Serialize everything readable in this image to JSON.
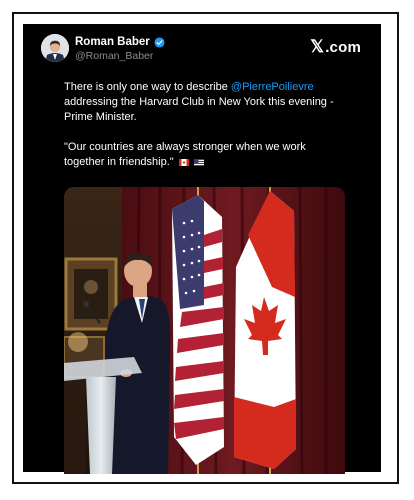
{
  "post": {
    "author": {
      "display_name": "Roman Baber",
      "handle": "@Roman_Baber",
      "verified": true
    },
    "brand": {
      "symbol": "𝕏",
      "label": ".com"
    },
    "text": {
      "line1_prefix": "There is only one way to describe ",
      "mention": "@PierrePoilievre",
      "line1_suffix": " addressing the Harvard Club in New York this evening - Prime Minister.",
      "quote": "\"Our countries are always stronger when we work together in friendship.\"",
      "emoji_flags": [
        "canada-flag",
        "usa-flag"
      ]
    },
    "media": {
      "alt": "Photo of speaker at podium between US and Canadian flags"
    }
  },
  "colors": {
    "background": "#000000",
    "mention": "#1d9bf0",
    "verified": "#1d9bf0",
    "text": "#ffffff",
    "handle": "#8b8b8b"
  }
}
